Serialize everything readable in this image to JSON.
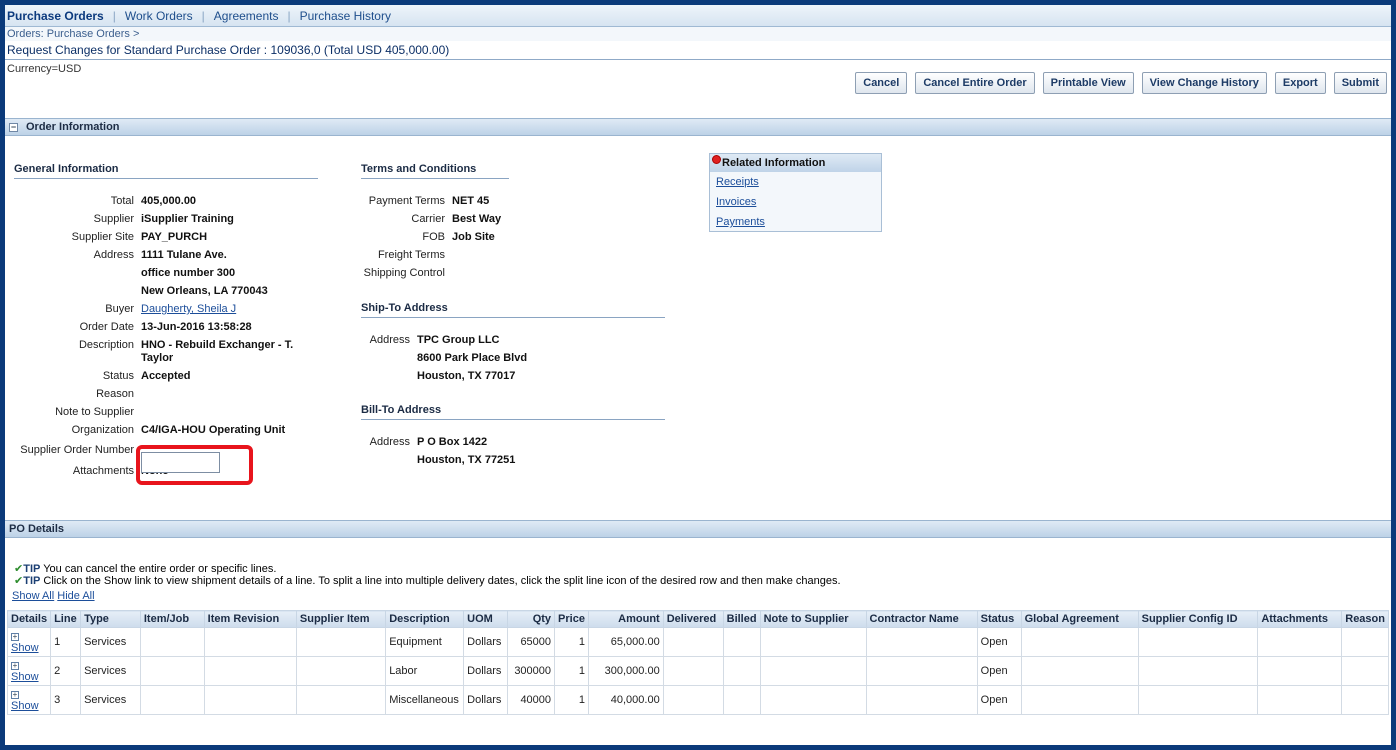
{
  "tabs": [
    {
      "label": "Purchase Orders",
      "active": true
    },
    {
      "label": "Work Orders"
    },
    {
      "label": "Agreements"
    },
    {
      "label": "Purchase History"
    }
  ],
  "breadcrumb": "Orders: Purchase Orders",
  "breadcrumb_sep": ">",
  "page_title": "Request Changes for Standard Purchase Order : 109036,0 (Total USD 405,000.00)",
  "currency": "Currency=USD",
  "buttons": {
    "cancel": "Cancel",
    "cancel_entire": "Cancel Entire Order",
    "printable": "Printable View",
    "history": "View Change History",
    "export": "Export",
    "submit": "Submit"
  },
  "order_info": {
    "header": "Order Information",
    "general": {
      "title": "General Information",
      "total_label": "Total",
      "total": "405,000.00",
      "supplier_label": "Supplier",
      "supplier": "iSupplier Training",
      "site_label": "Supplier Site",
      "site": "PAY_PURCH",
      "address_label": "Address",
      "address_1": "1111 Tulane Ave.",
      "address_2": "office number 300",
      "address_3": "New Orleans, LA 770043",
      "buyer_label": "Buyer",
      "buyer": "Daugherty, Sheila J",
      "order_date_label": "Order Date",
      "order_date": "13-Jun-2016 13:58:28",
      "description_label": "Description",
      "description_1": "HNO - Rebuild Exchanger - T.",
      "description_2": "Taylor",
      "status_label": "Status",
      "status": "Accepted",
      "reason_label": "Reason",
      "note_label": "Note to Supplier",
      "org_label": "Organization",
      "org": "C4/IGA-HOU Operating Unit",
      "son_label": "Supplier Order Number",
      "attach_label": "Attachments",
      "attach": "None"
    },
    "terms": {
      "title": "Terms and Conditions",
      "payment_label": "Payment Terms",
      "payment": "NET 45",
      "carrier_label": "Carrier",
      "carrier": "Best Way",
      "fob_label": "FOB",
      "fob": "Job Site",
      "freight_label": "Freight Terms",
      "shipping_label": "Shipping Control"
    },
    "ship_to": {
      "title": "Ship-To Address",
      "address_label": "Address",
      "line_1": "TPC Group LLC",
      "line_2": "8600 Park Place Blvd",
      "line_3": "Houston, TX 77017"
    },
    "bill_to": {
      "title": "Bill-To Address",
      "address_label": "Address",
      "line_1": "P O Box 1422",
      "line_2": "Houston, TX 77251"
    },
    "related": {
      "title": "Related Information",
      "links": [
        "Receipts",
        "Invoices",
        "Payments"
      ]
    }
  },
  "po_details": {
    "header": "PO Details",
    "tip_label": "TIP",
    "tip_1": "You can cancel the entire order or specific lines.",
    "tip_2": "Click on the Show link to view shipment details of a line. To split a line into multiple delivery dates, click the split line icon of the desired row and then make changes.",
    "show_all": "Show All",
    "hide_all": "Hide All",
    "columns": [
      "Details",
      "Line",
      "Type",
      "Item/Job",
      "Item Revision",
      "Supplier Item",
      "Description",
      "UOM",
      "Qty",
      "Price",
      "Amount",
      "Delivered",
      "Billed",
      "Note to Supplier",
      "Contractor Name",
      "Status",
      "Global Agreement",
      "Supplier Config ID",
      "Attachments",
      "Reason"
    ],
    "show_label": "Show",
    "rows": [
      {
        "line": "1",
        "type": "Services",
        "description": "Equipment",
        "uom": "Dollars",
        "qty": "65000",
        "price": "1",
        "amount": "65,000.00",
        "status": "Open"
      },
      {
        "line": "2",
        "type": "Services",
        "description": "Labor",
        "uom": "Dollars",
        "qty": "300000",
        "price": "1",
        "amount": "300,000.00",
        "status": "Open"
      },
      {
        "line": "3",
        "type": "Services",
        "description": "Miscellaneous",
        "uom": "Dollars",
        "qty": "40000",
        "price": "1",
        "amount": "40,000.00",
        "status": "Open"
      }
    ]
  },
  "colors": {
    "highlight": "#e8141c",
    "link": "#1c4e9a",
    "frame": "#0b3a7a"
  }
}
